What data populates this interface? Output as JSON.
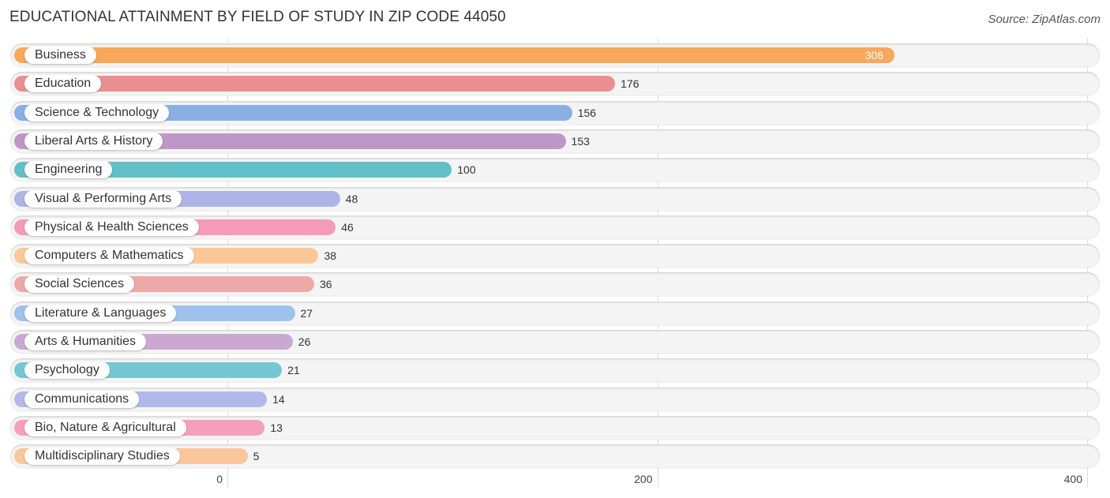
{
  "chart_data": {
    "type": "bar",
    "orientation": "horizontal",
    "title": "EDUCATIONAL ATTAINMENT BY FIELD OF STUDY IN ZIP CODE 44050",
    "source": "Source: ZipAtlas.com",
    "xlabel": "",
    "ylabel": "",
    "xlim": [
      0,
      400
    ],
    "xticks": [
      "0",
      "200",
      "400"
    ],
    "grid": true,
    "categories": [
      "Business",
      "Education",
      "Science & Technology",
      "Liberal Arts & History",
      "Engineering",
      "Visual & Performing Arts",
      "Physical & Health Sciences",
      "Computers & Mathematics",
      "Social Sciences",
      "Literature & Languages",
      "Arts & Humanities",
      "Psychology",
      "Communications",
      "Bio, Nature & Agricultural",
      "Multidisciplinary Studies"
    ],
    "values": [
      306,
      176,
      156,
      153,
      100,
      48,
      46,
      38,
      36,
      27,
      26,
      21,
      14,
      13,
      5
    ],
    "colors": [
      "#f7a85a",
      "#ea8f8f",
      "#8ab0e3",
      "#bd97c6",
      "#62bfc8",
      "#adb4e8",
      "#f59ab8",
      "#fac897",
      "#eda9a8",
      "#9fc2eb",
      "#c9a9d2",
      "#75c8d2",
      "#b2b8ea",
      "#f59fbd",
      "#fac69c"
    ]
  }
}
